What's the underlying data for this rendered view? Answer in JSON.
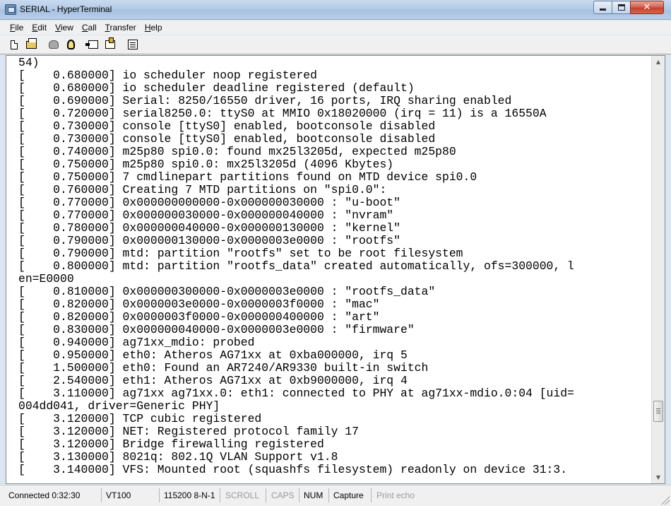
{
  "window": {
    "title": "SERIAL - HyperTerminal",
    "minimize": "",
    "maximize": "",
    "close": "✕"
  },
  "menu": [
    {
      "key": "F",
      "rest": "ile"
    },
    {
      "key": "E",
      "rest": "dit"
    },
    {
      "key": "V",
      "rest": "iew"
    },
    {
      "key": "C",
      "rest": "all"
    },
    {
      "key": "T",
      "rest": "ransfer"
    },
    {
      "key": "H",
      "rest": "elp"
    }
  ],
  "toolbar": {
    "icons": [
      "new-document-icon",
      "open-folder-icon",
      "phone-connect-icon",
      "disconnect-icon",
      "send-file-icon",
      "receive-file-icon",
      "properties-icon"
    ]
  },
  "terminal": {
    "lines": [
      "54)",
      "[    0.680000] io scheduler noop registered",
      "[    0.680000] io scheduler deadline registered (default)",
      "[    0.690000] Serial: 8250/16550 driver, 16 ports, IRQ sharing enabled",
      "[    0.720000] serial8250.0: ttyS0 at MMIO 0x18020000 (irq = 11) is a 16550A",
      "[    0.730000] console [ttyS0] enabled, bootconsole disabled",
      "[    0.730000] console [ttyS0] enabled, bootconsole disabled",
      "[    0.740000] m25p80 spi0.0: found mx25l3205d, expected m25p80",
      "[    0.750000] m25p80 spi0.0: mx25l3205d (4096 Kbytes)",
      "[    0.750000] 7 cmdlinepart partitions found on MTD device spi0.0",
      "[    0.760000] Creating 7 MTD partitions on \"spi0.0\":",
      "[    0.770000] 0x000000000000-0x000000030000 : \"u-boot\"",
      "[    0.770000] 0x000000030000-0x000000040000 : \"nvram\"",
      "[    0.780000] 0x000000040000-0x000000130000 : \"kernel\"",
      "[    0.790000] 0x000000130000-0x0000003e0000 : \"rootfs\"",
      "[    0.790000] mtd: partition \"rootfs\" set to be root filesystem",
      "[    0.800000] mtd: partition \"rootfs_data\" created automatically, ofs=300000, l",
      "en=E0000",
      "[    0.810000] 0x000000300000-0x0000003e0000 : \"rootfs_data\"",
      "[    0.820000] 0x0000003e0000-0x0000003f0000 : \"mac\"",
      "[    0.820000] 0x0000003f0000-0x000000400000 : \"art\"",
      "[    0.830000] 0x000000040000-0x0000003e0000 : \"firmware\"",
      "[    0.940000] ag71xx_mdio: probed",
      "[    0.950000] eth0: Atheros AG71xx at 0xba000000, irq 5",
      "[    1.500000] eth0: Found an AR7240/AR9330 built-in switch",
      "[    2.540000] eth1: Atheros AG71xx at 0xb9000000, irq 4",
      "[    3.110000] ag71xx ag71xx.0: eth1: connected to PHY at ag71xx-mdio.0:04 [uid=",
      "004dd041, driver=Generic PHY]",
      "[    3.120000] TCP cubic registered",
      "[    3.120000] NET: Registered protocol family 17",
      "[    3.120000] Bridge firewalling registered",
      "[    3.130000] 8021q: 802.1Q VLAN Support v1.8",
      "[    3.140000] VFS: Mounted root (squashfs filesystem) readonly on device 31:3."
    ]
  },
  "status": {
    "connected": "Connected 0:32:30",
    "emulation": "VT100",
    "port_settings": "115200 8-N-1",
    "scroll": "SCROLL",
    "caps": "CAPS",
    "num": "NUM",
    "capture": "Capture",
    "print_echo": "Print echo"
  }
}
